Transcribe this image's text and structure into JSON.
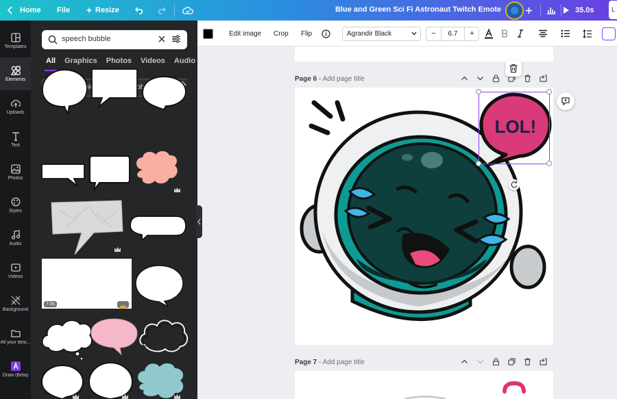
{
  "topbar": {
    "home_label": "Home",
    "file_label": "File",
    "resize_label": "Resize",
    "doc_title": "Blue and Green Sci Fi Astronaut Twitch Emote",
    "play_label": "35.0s"
  },
  "rail": {
    "items": [
      {
        "label": "Templates",
        "icon": "templates-icon"
      },
      {
        "label": "Elements",
        "icon": "elements-icon"
      },
      {
        "label": "Uploads",
        "icon": "uploads-icon"
      },
      {
        "label": "Text",
        "icon": "text-icon"
      },
      {
        "label": "Photos",
        "icon": "photos-icon"
      },
      {
        "label": "Styles",
        "icon": "styles-icon"
      },
      {
        "label": "Audio",
        "icon": "audio-icon"
      },
      {
        "label": "Videos",
        "icon": "videos-icon"
      },
      {
        "label": "Background",
        "icon": "background-icon"
      },
      {
        "label": "All your desi...",
        "icon": "folder-icon"
      },
      {
        "label": "Draw (Beta)",
        "icon": "draw-icon"
      }
    ]
  },
  "panel": {
    "search_value": "speech bubble",
    "tabs": [
      "All",
      "Graphics",
      "Photos",
      "Videos",
      "Audio"
    ],
    "chips": [
      "Thought bubble",
      "Comic bubble",
      "Speech"
    ],
    "video_duration": "7.0s"
  },
  "toolbar": {
    "edit_image": "Edit image",
    "crop": "Crop",
    "flip": "Flip",
    "font_name": "Agrandir Black",
    "font_size": "6.7",
    "minus": "−",
    "plus": "+"
  },
  "canvas": {
    "page6_label": "Page 6",
    "page6_title_placeholder": "Add page title",
    "page7_label": "Page 7",
    "page7_title_placeholder": "Add page title",
    "sticker_text": "LOL!",
    "separator": " - "
  },
  "colors": {
    "accent": "#8b3dff",
    "pink": "#d93a7a",
    "teal": "#0e9b94",
    "visor": "#0e3f3c"
  }
}
